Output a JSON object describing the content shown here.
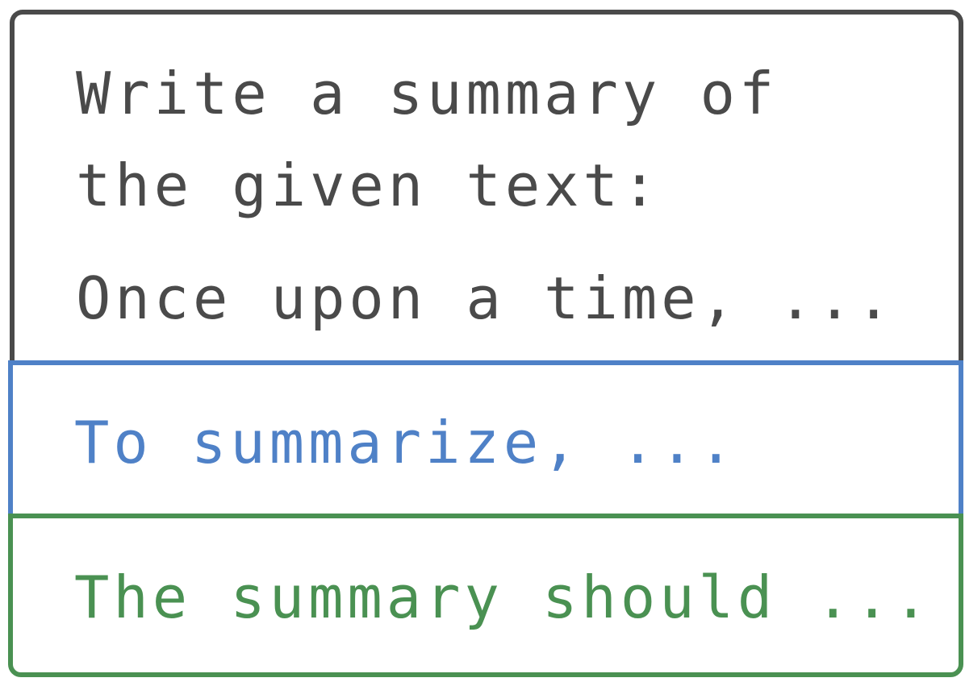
{
  "instruction": {
    "line1": "Write a summary of",
    "line2": "the given text:",
    "line3": "Once upon a time, ..."
  },
  "response": {
    "text": "To summarize, ..."
  },
  "constraint": {
    "text": "The summary should ..."
  },
  "colors": {
    "instruction_border": "#4a4a4a",
    "response": "#4f81c7",
    "constraint": "#4a9152"
  }
}
